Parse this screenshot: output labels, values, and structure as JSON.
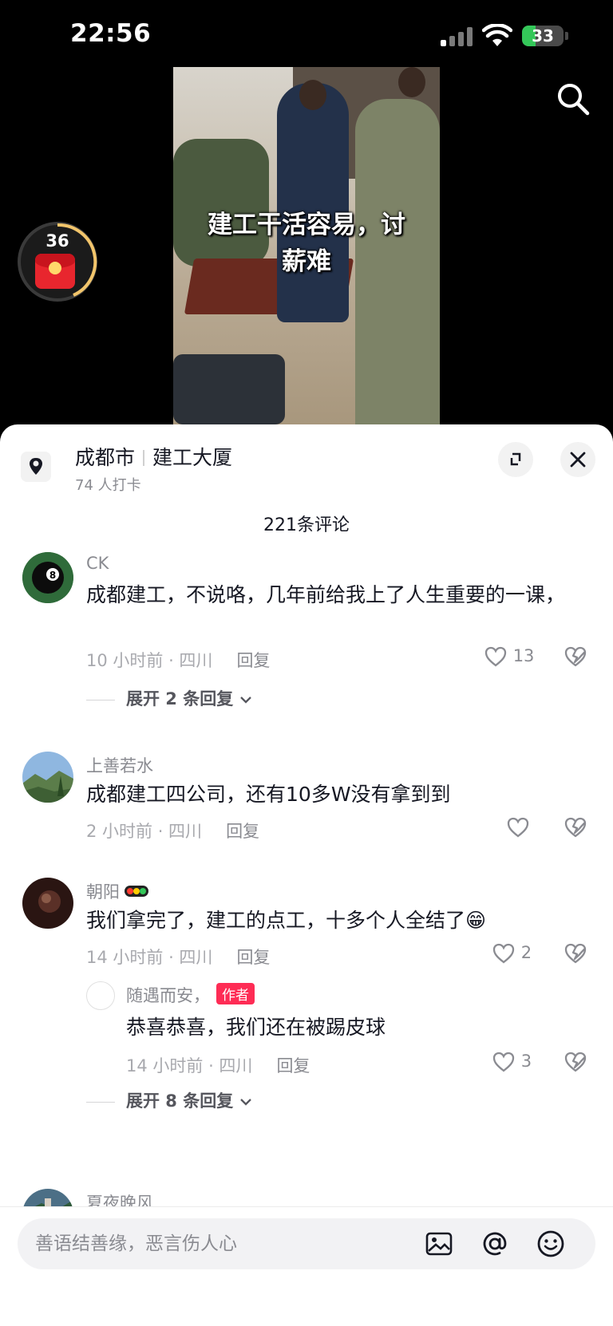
{
  "status_bar": {
    "time": "22:56",
    "battery": "33",
    "battery_level": 0.33
  },
  "video": {
    "caption": "建工干活容易，讨薪难"
  },
  "redpacket": {
    "count": "36"
  },
  "location": {
    "city": "成都市",
    "place": "建工大厦",
    "checkins": "74 人打卡"
  },
  "comments_header": {
    "count_label": "221条评论"
  },
  "comments": [
    {
      "name": "CK",
      "text": "成都建工，不说咯，几年前给我上了人生重要的一课，",
      "time": "10 小时前 · 四川",
      "reply": "回复",
      "likes": "13",
      "expand": "展开 2 条回复"
    },
    {
      "name": "上善若水",
      "text": "成都建工四公司，还有10多W没有拿到到",
      "time": "2 小时前 · 四川",
      "reply": "回复",
      "likes": ""
    },
    {
      "name": "朝阳",
      "text": "我们拿完了，建工的点工，十多个人全结了😁",
      "time": "14 小时前 · 四川",
      "reply": "回复",
      "likes": "2",
      "sub_reply": {
        "name": "随遇而安，",
        "badge": "作者",
        "text": "恭喜恭喜，我们还在被踢皮球",
        "time": "14 小时前 · 四川",
        "reply": "回复",
        "likes": "3"
      },
      "expand": "展开 8 条回复"
    },
    {
      "name": "夏夜晚风"
    }
  ],
  "input": {
    "placeholder": "善语结善缘，恶言伤人心"
  }
}
